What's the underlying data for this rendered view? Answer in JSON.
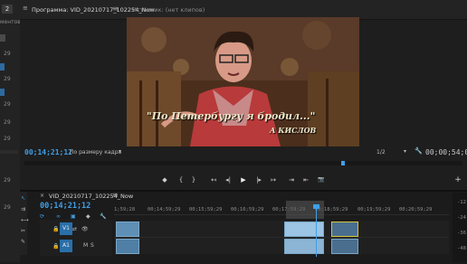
{
  "left_panel": {
    "badge": "2",
    "text1": "ментов",
    "num1": "29",
    "num2": "29",
    "num3": "29",
    "num4": "29",
    "num5": "29",
    "num6": "29",
    "num7": "29"
  },
  "monitor": {
    "program_tab": "Программа: VID_20210717_102254_Now",
    "source_tab": "Источник: (нет клипов)",
    "timecode_current": "00;14;21;12",
    "fit_label": "По размеру кадра",
    "resolution": "1/2",
    "timecode_total": "00;00;54;02",
    "title_line1": "\"По Петербургу я бродил...\"",
    "title_line2": "А КИСЛОВ"
  },
  "transport": {
    "marker": "◆",
    "in": "{",
    "out": "}",
    "goto_in": "↤",
    "step_back": "◂|",
    "play": "▶",
    "step_fwd": "|▸",
    "goto_out": "↦",
    "insert": "⇥",
    "overwrite": "⇤",
    "export": "📷",
    "add": "+"
  },
  "timeline": {
    "sequence_tab": "VID_20210717_102254_Now",
    "timecode": "00;14;21;12",
    "ruler": [
      "1;59;28",
      "00;14;59;29",
      "00;15;59;29",
      "00;16;59;29",
      "00;17;59;29",
      "00;18;59;29",
      "00;19;59;29",
      "00;20;59;29"
    ],
    "v1": "V1",
    "a1": "A1",
    "v_label": "V1",
    "a_label": "A1",
    "m": "M",
    "s": "S",
    "meter_labels": [
      "-12",
      "-24",
      "-36",
      "-48"
    ]
  },
  "colors": {
    "accent": "#3fa0e8",
    "playhead": "#3fa0e8",
    "clip": "#7aa7c7",
    "clip_yellow": "#d4c43a"
  }
}
